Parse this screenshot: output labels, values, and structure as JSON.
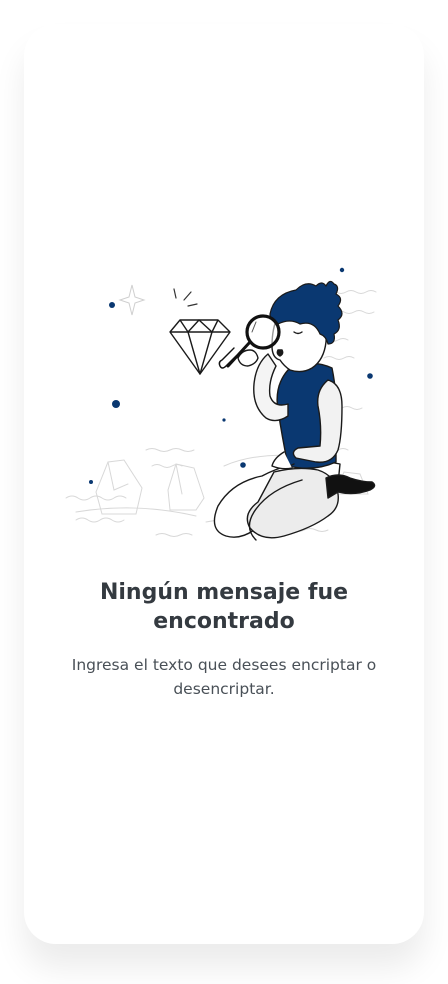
{
  "empty_state": {
    "title": "Ningún mensaje fue encontrado",
    "message": "Ingresa el texto que desees encriptar o desencriptar.",
    "illustration_icon": "person-with-magnifying-glass-and-diamond-illustration"
  },
  "colors": {
    "page_background": "#ffffff",
    "card_background": "#ffffff",
    "title_text": "#343a40",
    "body_text": "#495057",
    "accent": "#0a3871"
  }
}
